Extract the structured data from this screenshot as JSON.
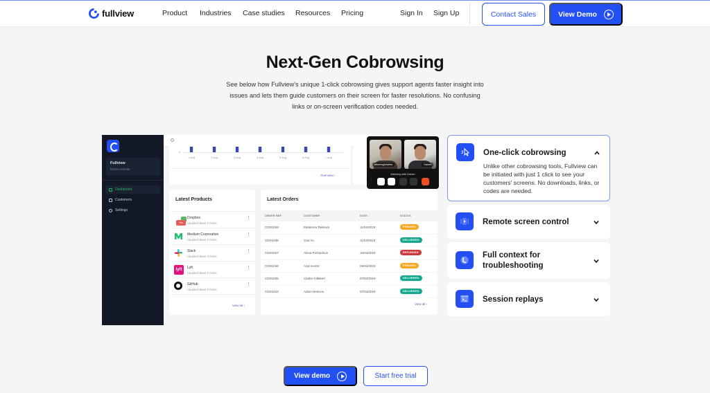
{
  "brand": {
    "name": "fullview",
    "accent": "#2350f5"
  },
  "nav": {
    "items": [
      "Product",
      "Industries",
      "Case studies",
      "Resources",
      "Pricing"
    ],
    "sign_in": "Sign In",
    "sign_up": "Sign Up",
    "contact_sales": "Contact Sales",
    "view_demo": "View Demo"
  },
  "hero": {
    "title": "Next-Gen Cobrowsing",
    "subtitle": "See below how Fullview's unique 1-click cobrowsing gives support agents faster insight into issues and lets them guide customers on their screen for faster resolutions. No confusing links or on-screen verification codes needed."
  },
  "dashboard": {
    "org_name": "Fullview",
    "org_sub": "Demo website",
    "sidebar": [
      {
        "label": "Dashboard",
        "active": true
      },
      {
        "label": "Customers",
        "active": false
      },
      {
        "label": "Settings",
        "active": false
      }
    ],
    "chart": {
      "zero_label": "0",
      "x_labels": [
        "1 Aug",
        "2 Aug",
        "3 Aug",
        "4 Aug",
        "5 Aug",
        "6 Aug",
        "7 aug"
      ],
      "overview_link": "Overview"
    },
    "products": {
      "title": "Latest Products",
      "items": [
        {
          "name": "Dropbox",
          "updated": "Updated about 2 hours"
        },
        {
          "name": "Medium Corporation",
          "updated": "Updated about 2 hours"
        },
        {
          "name": "Slack",
          "updated": "Updated about 3 hours"
        },
        {
          "name": "Lyft",
          "updated": "Updated about 5 hours"
        },
        {
          "name": "GitHub",
          "updated": "Updated about 9 hours"
        }
      ],
      "you_tag": "You",
      "view_all": "View all"
    },
    "orders": {
      "title": "Latest Orders",
      "columns": [
        "ORDER REF",
        "CUSTOMER",
        "DATE",
        "STATUS"
      ],
      "rows": [
        {
          "ref": "CDD1049",
          "customer": "Ekaterina Tankova",
          "date": "11/04/2019",
          "status": "PENDING"
        },
        {
          "ref": "CDD1048",
          "customer": "Cao Yu",
          "date": "11/04/2019",
          "status": "DELIVERED"
        },
        {
          "ref": "CDD1047",
          "customer": "Alexa Richardson",
          "date": "10/04/2019",
          "status": "REFUNDED"
        },
        {
          "ref": "CDD1046",
          "customer": "Anje Keizer",
          "date": "08/04/2019",
          "status": "PENDING"
        },
        {
          "ref": "CDD1045",
          "customer": "Clarke Gillebert",
          "date": "07/04/2019",
          "status": "DELIVERED"
        },
        {
          "ref": "CDD1044",
          "customer": "Adam Denisov",
          "date": "07/04/2019",
          "status": "DELIVERED"
        }
      ],
      "status_colors": {
        "PENDING": "#f5a623",
        "DELIVERED": "#14a88e",
        "REFUNDED": "#d0383e"
      },
      "view_all": "View all"
    },
    "video_call": {
      "participant_1": "albertogfullview",
      "participant_2": "Daniel",
      "title": "Meeting with Daniel"
    }
  },
  "features": [
    {
      "title": "One-click cobrowsing",
      "icon": "cursor-click-icon",
      "open": true,
      "description": "Unlike other cobrowsing tools, Fullview can be initiated with just 1 click to see your customers' screens. No downloads, links, or codes are needed."
    },
    {
      "title": "Remote screen control",
      "icon": "screen-control-icon",
      "open": false
    },
    {
      "title": "Full context for troubleshooting",
      "icon": "clock-icon",
      "open": false
    },
    {
      "title": "Session replays",
      "icon": "terminal-icon",
      "open": false
    }
  ],
  "cta": {
    "view_demo": "View demo",
    "start_trial": "Start free trial"
  }
}
